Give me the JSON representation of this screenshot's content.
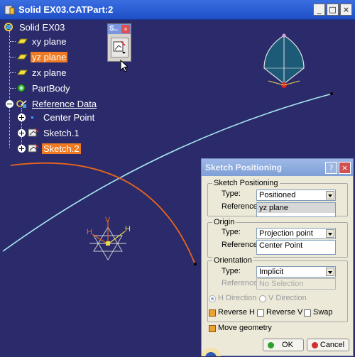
{
  "window": {
    "title": "Solid EX03.CATPart:2",
    "controls": {
      "minimize": "_",
      "maximize": "□",
      "close": "×"
    }
  },
  "tree": {
    "root": "Solid EX03",
    "items": [
      {
        "label": "xy plane",
        "icon": "plane-icon",
        "selected": false
      },
      {
        "label": "yz plane",
        "icon": "plane-icon",
        "selected": true
      },
      {
        "label": "zx plane",
        "icon": "plane-icon",
        "selected": false
      },
      {
        "label": "PartBody",
        "icon": "gear-body-icon",
        "selected": false
      },
      {
        "label": "Reference Data",
        "icon": "geometrical-set-icon",
        "selected": false
      },
      {
        "label": "Center Point",
        "icon": "point-icon",
        "selected": false
      },
      {
        "label": "Sketch.1",
        "icon": "sketch-icon",
        "selected": false
      },
      {
        "label": "Sketch.2",
        "icon": "sketch-icon",
        "selected": true
      }
    ]
  },
  "mini_toolbar": {
    "title": "S..",
    "close": "×"
  },
  "axis_labels": {
    "h": "H",
    "v": "V"
  },
  "dialog": {
    "title": "Sketch Positioning",
    "help": "?",
    "close": "×",
    "sketch_positioning": {
      "group_label": "Sketch Positioning",
      "type_label": "Type:",
      "type_value": "Positioned",
      "reference_label": "Reference:",
      "reference_value": "yz plane"
    },
    "origin": {
      "group_label": "Origin",
      "type_label": "Type:",
      "type_value": "Projection point",
      "reference_label": "Reference:",
      "reference_value": "Center Point"
    },
    "orientation": {
      "group_label": "Orientation",
      "type_label": "Type:",
      "type_value": "Implicit",
      "reference_label": "Reference:",
      "reference_value": "No Selection",
      "h_direction": "H Direction",
      "v_direction": "V Direction",
      "reverse_h": "Reverse H",
      "reverse_v": "Reverse V",
      "swap": "Swap"
    },
    "move_geometry": "Move geometry",
    "ok": "OK",
    "cancel": "Cancel"
  },
  "colors": {
    "viewport_bg": "#2b2b6b",
    "selection_orange": "#ef7a22",
    "curve_cyan": "#a8e6f0",
    "curve_orange": "#e8651a"
  }
}
